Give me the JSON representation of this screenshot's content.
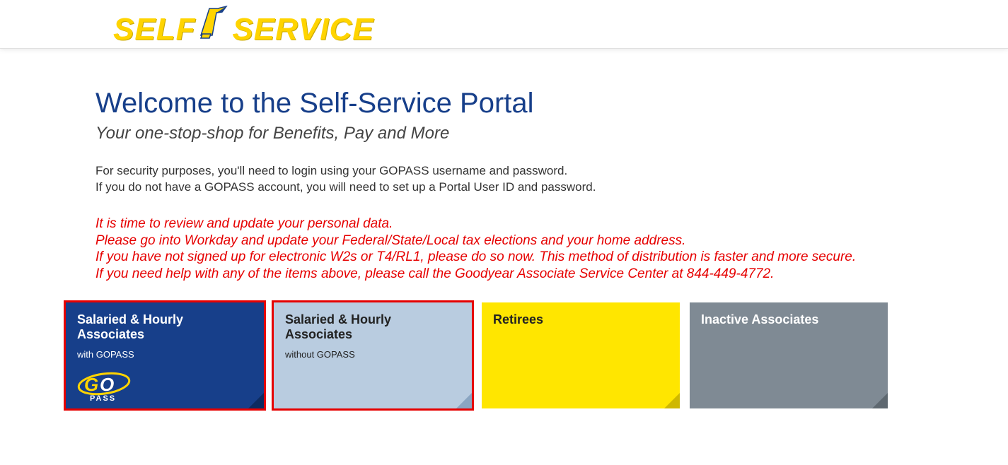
{
  "header": {
    "logo_word1": "SELF",
    "logo_word2": "SERVICE"
  },
  "main": {
    "title": "Welcome to the Self-Service Portal",
    "subtitle": "Your one-stop-shop for Benefits, Pay and More",
    "info_line1": "For security purposes, you'll need to login using your GOPASS username and password.",
    "info_line2": "If you do not have a GOPASS account, you will need to set up a Portal User ID and password.",
    "alert_line1": "It is time to review and update your personal data.",
    "alert_line2": "Please go into Workday and update your Federal/State/Local tax elections and your home address.",
    "alert_line3": "If you have not signed up for electronic W2s or T4/RL1, please do so now. This method of distribution is faster and more secure.",
    "alert_line4": "If you need help with any of the items above, please call the Goodyear Associate Service Center at 844-449-4772."
  },
  "tiles": [
    {
      "title": "Salaried & Hourly Associates",
      "subtitle": "with GOPASS",
      "logo_text1": "GO",
      "logo_text2": "PASS"
    },
    {
      "title": "Salaried & Hourly Associates",
      "subtitle": "without GOPASS"
    },
    {
      "title": "Retirees"
    },
    {
      "title": "Inactive Associates"
    }
  ]
}
